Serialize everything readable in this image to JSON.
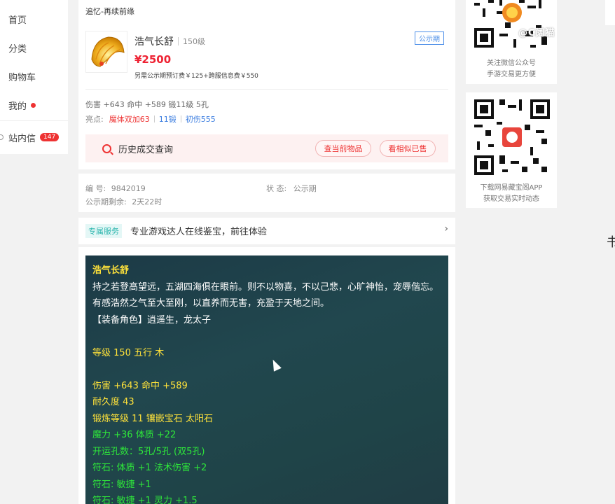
{
  "nav": {
    "items": [
      {
        "label": "首页"
      },
      {
        "label": "分类"
      },
      {
        "label": "购物车"
      },
      {
        "label": "我的"
      },
      {
        "label": "站内信",
        "badge": "147"
      }
    ]
  },
  "item": {
    "breadcrumb": "追忆-再续前缘",
    "name": "浩气长舒",
    "level": "150级",
    "price": "¥2500",
    "fee": "另需公示期预订费￥125+跨服信息费￥550",
    "status_tag": "公示期",
    "stats": "伤害 +643 命中 +589 锻11级 5孔",
    "highlights_label": "亮点:",
    "highlights": [
      "魔体双加63",
      "11锻",
      "初伤555"
    ]
  },
  "history": {
    "title": "历史成交查询",
    "btn_current": "查当前物品",
    "btn_similar": "看相似已售"
  },
  "meta": {
    "id_label": "编 号:",
    "id_value": "9842019",
    "status_label": "状 态:",
    "status_value": "公示期",
    "remain_label": "公示期剩余:",
    "remain_value": "2天22时"
  },
  "service": {
    "tag": "专属服务",
    "text": "专业游戏达人在线鉴宝，前往体验",
    "chevron": "›"
  },
  "description": {
    "title": "浩气长舒",
    "para1": "持之若登高望远，五湖四海俱在眼前。则不以物喜，不以己悲，心旷神怡，宠辱偕忘。有感浩然之气至大至刚，以直养而无害，充盈于天地之间。",
    "role": "【装备角色】逍遥生，龙太子",
    "level_line": "等级 150 五行 木",
    "attack": "伤害 +643 命中 +589",
    "durability": "耐久度 43",
    "forge": "锻炼等级 11 镶嵌宝石 太阳石",
    "magic": "魔力 +36 体质 +22",
    "holes": "开运孔数：5孔/5孔 (双5孔)",
    "rune1": "符石: 体质 +1 法术伤害 +2",
    "rune2": "符石: 敏捷 +1",
    "rune3": "符石: 敏捷 +1 灵力 +1.5"
  },
  "right": {
    "qr1_caption_1": "关注微信公众号",
    "qr1_caption_2": "手游交易更方便",
    "qr2_caption_1": "下载网易藏宝阁APP",
    "qr2_caption_2": "获取交易实时动态",
    "watermark": "@C阔猫",
    "edge_glyph": "书"
  },
  "colors": {
    "price_red": "#e23333",
    "link_blue": "#3b7de0",
    "desc_yellow": "#ffe23a",
    "desc_green": "#2ee63a"
  }
}
